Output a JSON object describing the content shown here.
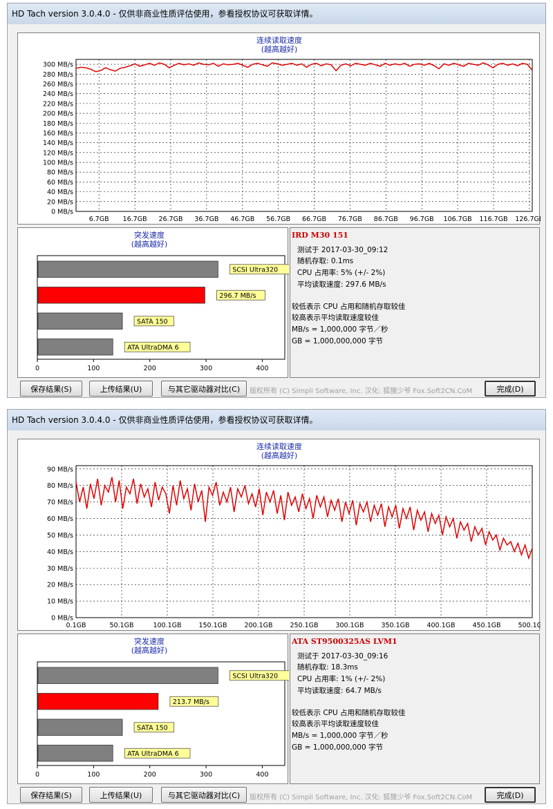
{
  "windows": [
    {
      "title": "HD Tach version 3.0.4.0  - 仅供非商业性质评估使用，参看授权协议可获取详情。",
      "read_chart": {
        "title1": "连续读取速度",
        "title2": "(越高越好)",
        "y_labels": [
          "300 MB/s",
          "280 MB/s",
          "260 MB/s",
          "240 MB/s",
          "220 MB/s",
          "200 MB/s",
          "180 MB/s",
          "160 MB/s",
          "140 MB/s",
          "120 MB/s",
          "100 MB/s",
          "80 MB/s",
          "60 MB/s",
          "40 MB/s",
          "20 MB/s",
          "0 MB/s"
        ],
        "x_labels": [
          "6.7GB",
          "16.7GB",
          "26.7GB",
          "36.7GB",
          "46.7GB",
          "56.7GB",
          "66.7GB",
          "76.7GB",
          "86.7GB",
          "96.7GB",
          "106.7GB",
          "116.7GB",
          "126.7GB"
        ]
      },
      "burst_chart": {
        "title1": "突发速度",
        "title2": "(越高越好)",
        "bars": [
          {
            "label": "SCSI Ultra320",
            "value": 320,
            "color": "#808080"
          },
          {
            "label": "296.7 MB/s",
            "value": 296.7,
            "color": "#ff0000"
          },
          {
            "label": "SATA 150",
            "value": 150,
            "color": "#808080"
          },
          {
            "label": "ATA UltraDMA 6",
            "value": 133,
            "color": "#808080"
          }
        ],
        "ticks": [
          "0",
          "100",
          "200",
          "300",
          "400"
        ]
      },
      "info": {
        "drive": "IRD M30 151",
        "tested": "测试于 2017-03-30_09:12",
        "random": "随机存取: 0.1ms",
        "cpu": "CPU 占用率: 5% (+/- 2%)",
        "avg": "平均读取速度: 297.6 MB/s",
        "note1": "较低表示 CPU 占用和随机存取较佳",
        "note2": "较高表示平均读取速度较佳",
        "note3": "MB/s = 1,000,000 字节／秒",
        "note4": "GB = 1,000,000,000 字节"
      },
      "buttons": {
        "save": "保存结果(S)",
        "upload": "上传结果(U)",
        "compare": "与其它驱动器对比(C)",
        "done": "完成(D)"
      },
      "copyright": "版权所有 (C) Simpli Software, Inc. 汉化: 狐狸少爷 Fox.Soft2CN.CoM"
    },
    {
      "title": "HD Tach version 3.0.4.0  - 仅供非商业性质评估使用，参看授权协议可获取详情。",
      "read_chart": {
        "title1": "连续读取速度",
        "title2": "(越高越好)",
        "y_labels": [
          "90 MB/s",
          "80 MB/s",
          "70 MB/s",
          "60 MB/s",
          "50 MB/s",
          "40 MB/s",
          "30 MB/s",
          "20 MB/s",
          "10 MB/s",
          "0 MB/s"
        ],
        "x_labels": [
          "0.1GB",
          "50.1GB",
          "100.1GB",
          "150.1GB",
          "200.1GB",
          "250.1GB",
          "300.1GB",
          "350.1GB",
          "400.1GB",
          "450.1GB",
          "500.1GB"
        ]
      },
      "burst_chart": {
        "title1": "突发速度",
        "title2": "(越高越好)",
        "bars": [
          {
            "label": "SCSI Ultra320",
            "value": 320,
            "color": "#808080"
          },
          {
            "label": "213.7 MB/s",
            "value": 213.7,
            "color": "#ff0000"
          },
          {
            "label": "SATA 150",
            "value": 150,
            "color": "#808080"
          },
          {
            "label": "ATA UltraDMA 6",
            "value": 133,
            "color": "#808080"
          }
        ],
        "ticks": [
          "0",
          "100",
          "200",
          "300",
          "400"
        ]
      },
      "info": {
        "drive": "ATA ST9500325AS LVM1",
        "tested": "测试于 2017-03-30_09:16",
        "random": "随机存取: 18.3ms",
        "cpu": "CPU 占用率: 1% (+/- 2%)",
        "avg": "平均读取速度: 64.7 MB/s",
        "note1": "较低表示 CPU 占用和随机存取较佳",
        "note2": "较高表示平均读取速度较佳",
        "note3": "MB/s = 1,000,000 字节／秒",
        "note4": "GB = 1,000,000,000 字节"
      },
      "buttons": {
        "save": "保存结果(S)",
        "upload": "上传结果(U)",
        "compare": "与其它驱动器对比(C)",
        "done": "完成(D)"
      },
      "copyright": "版权所有 (C) Simpli Software, Inc. 汉化: 狐狸少爷 Fox.Soft2CN.CoM"
    }
  ],
  "chart_data": [
    {
      "type": "line",
      "title": "连续读取速度",
      "subtitle": "(越高越好)",
      "ylim": [
        0,
        310
      ],
      "x": [
        "6.7GB",
        "16.7GB",
        "26.7GB",
        "36.7GB",
        "46.7GB",
        "56.7GB",
        "66.7GB",
        "76.7GB",
        "86.7GB",
        "96.7GB",
        "106.7GB",
        "116.7GB",
        "126.7GB"
      ],
      "xlim": [
        0.3,
        127.5
      ],
      "grid": true,
      "series": [
        {
          "color": "#e00000",
          "values": [
            292,
            294,
            293,
            290,
            285,
            287,
            293,
            289,
            286,
            292,
            294,
            297,
            301,
            296,
            299,
            302,
            298,
            303,
            300,
            293,
            298,
            302,
            299,
            301,
            298,
            303,
            300,
            299,
            302,
            296,
            301,
            299,
            300,
            302,
            298,
            294,
            300,
            302,
            299,
            296,
            303,
            301,
            298,
            300,
            302,
            298,
            301,
            294,
            300,
            302,
            297,
            301,
            299,
            287,
            298,
            301,
            297,
            302,
            300,
            298,
            302,
            299,
            296,
            302,
            298,
            301,
            299,
            302,
            296,
            300,
            301,
            298,
            302,
            297,
            291,
            301,
            298,
            302,
            299,
            296,
            302,
            300,
            298,
            303,
            299,
            293,
            300,
            302,
            298,
            301,
            297,
            302,
            300,
            288
          ]
        }
      ]
    },
    {
      "type": "bar",
      "title": "突发速度",
      "subtitle": "(越高越好)",
      "categories": [
        "SCSI Ultra320",
        "296.7 MB/s",
        "SATA 150",
        "ATA UltraDMA 6"
      ],
      "values": [
        320,
        296.7,
        150,
        133
      ],
      "xlim": [
        0,
        440
      ]
    },
    {
      "type": "line",
      "title": "连续读取速度",
      "subtitle": "(越高越好)",
      "ylim": [
        0,
        92
      ],
      "x": [
        "0.1GB",
        "50.1GB",
        "100.1GB",
        "150.1GB",
        "200.1GB",
        "250.1GB",
        "300.1GB",
        "350.1GB",
        "400.1GB",
        "450.1GB",
        "500.1GB"
      ],
      "xlim": [
        0.1,
        500.1
      ],
      "grid": true,
      "series": [
        {
          "color": "#e00000",
          "values": [
            82,
            70,
            79,
            66,
            81,
            72,
            84,
            68,
            80,
            76,
            85,
            70,
            83,
            66,
            79,
            75,
            84,
            69,
            81,
            73,
            78,
            67,
            82,
            71,
            79,
            75,
            63,
            80,
            68,
            83,
            72,
            78,
            65,
            81,
            70,
            77,
            58,
            79,
            74,
            82,
            68,
            76,
            70,
            79,
            64,
            78,
            73,
            80,
            69,
            75,
            67,
            78,
            62,
            76,
            70,
            77,
            63,
            74,
            59,
            76,
            68,
            73,
            64,
            75,
            66,
            72,
            60,
            74,
            67,
            73,
            61,
            71,
            65,
            72,
            58,
            70,
            63,
            71,
            56,
            69,
            64,
            70,
            58,
            68,
            62,
            69,
            55,
            67,
            61,
            68,
            54,
            66,
            60,
            67,
            53,
            65,
            59,
            64,
            52,
            63,
            57,
            62,
            50,
            61,
            55,
            60,
            48,
            58,
            53,
            57,
            46,
            55,
            50,
            54,
            44,
            52,
            47,
            50,
            41,
            48,
            44,
            46,
            40,
            45,
            38,
            44,
            36,
            42
          ]
        }
      ]
    },
    {
      "type": "bar",
      "title": "突发速度",
      "subtitle": "(越高越好)",
      "categories": [
        "SCSI Ultra320",
        "213.7 MB/s",
        "SATA 150",
        "ATA UltraDMA 6"
      ],
      "values": [
        320,
        213.7,
        150,
        133
      ],
      "xlim": [
        0,
        440
      ]
    }
  ]
}
